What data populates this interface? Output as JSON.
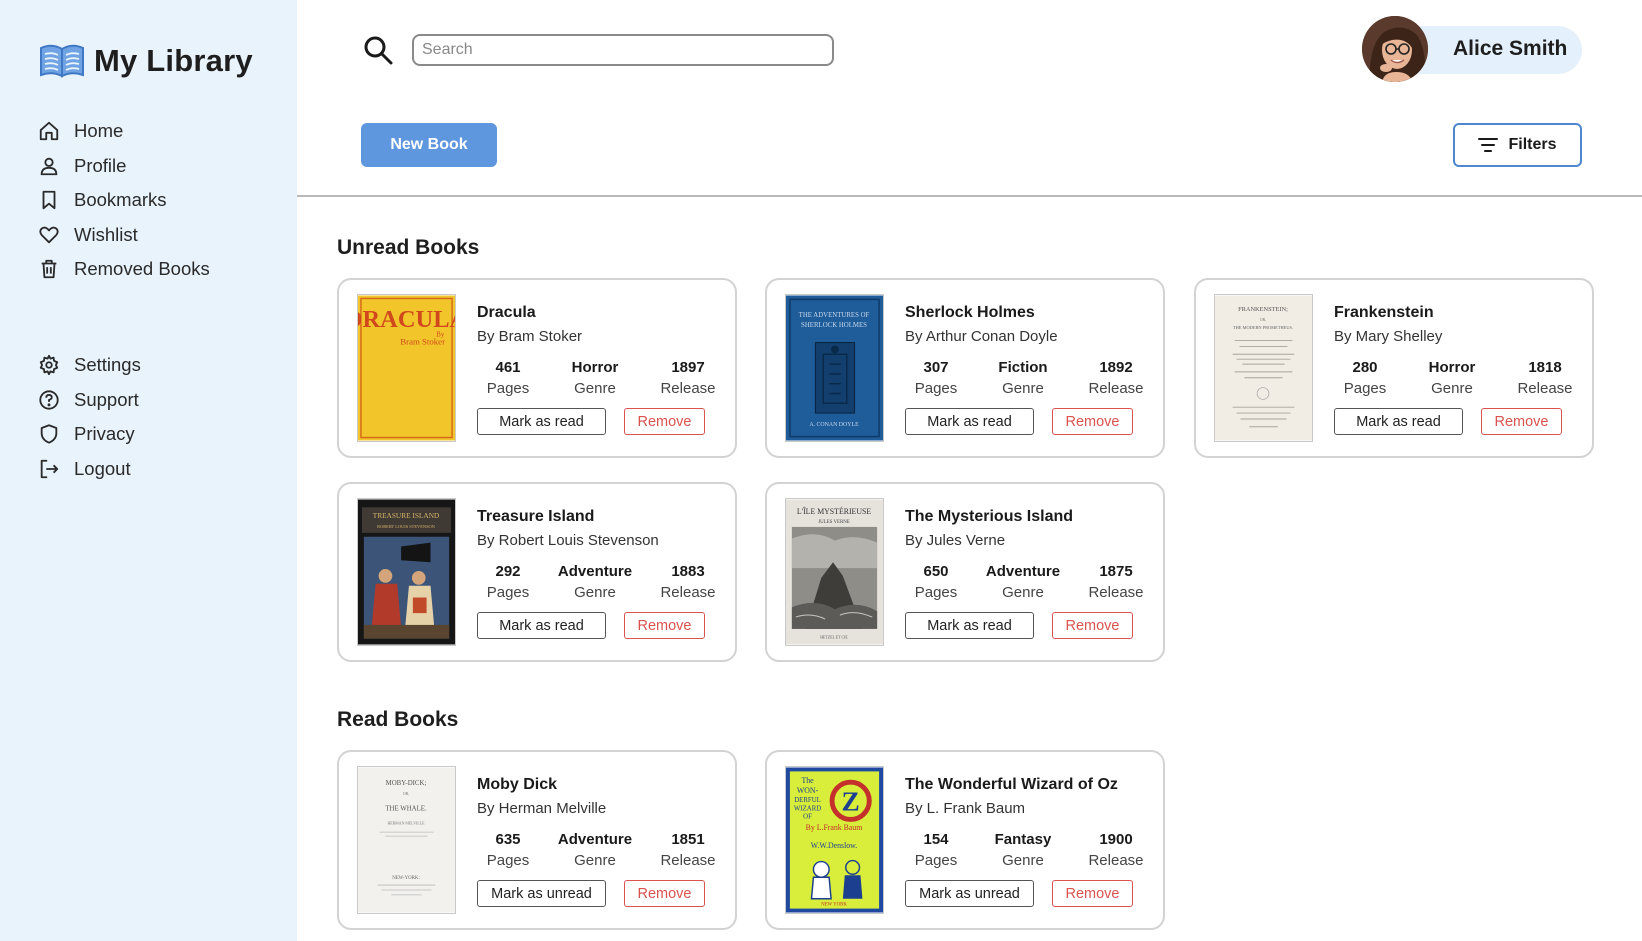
{
  "app": {
    "title": "My Library",
    "accent_color": "#5f97df",
    "sidebar_color": "#e9f3fc",
    "danger_color": "#d9534f"
  },
  "sidebar": {
    "primary": [
      {
        "label": "Home",
        "icon": "home-icon"
      },
      {
        "label": "Profile",
        "icon": "user-icon"
      },
      {
        "label": "Bookmarks",
        "icon": "bookmark-icon"
      },
      {
        "label": "Wishlist",
        "icon": "heart-icon"
      },
      {
        "label": "Removed Books",
        "icon": "trash-icon"
      }
    ],
    "secondary": [
      {
        "label": "Settings",
        "icon": "gear-icon"
      },
      {
        "label": "Support",
        "icon": "help-circle-icon"
      },
      {
        "label": "Privacy",
        "icon": "shield-icon"
      },
      {
        "label": "Logout",
        "icon": "logout-icon"
      }
    ]
  },
  "header": {
    "search_placeholder": "Search",
    "search_value": "",
    "user_name": "Alice Smith",
    "new_book_label": "New Book",
    "filters_label": "Filters"
  },
  "sections": {
    "unread_title": "Unread Books",
    "read_title": "Read Books"
  },
  "stat_labels": {
    "pages": "Pages",
    "genre": "Genre",
    "release": "Release"
  },
  "actions": {
    "mark_read": "Mark as read",
    "mark_unread": "Mark as unread",
    "remove": "Remove"
  },
  "unread_books": [
    {
      "title": "Dracula",
      "author": "By Bram Stoker",
      "pages": "461",
      "genre": "Horror",
      "release": "1897",
      "cover": "dracula-cover"
    },
    {
      "title": "Sherlock Holmes",
      "author": "By Arthur Conan Doyle",
      "pages": "307",
      "genre": "Fiction",
      "release": "1892",
      "cover": "sherlock-cover"
    },
    {
      "title": "Frankenstein",
      "author": "By Mary Shelley",
      "pages": "280",
      "genre": "Horror",
      "release": "1818",
      "cover": "frankenstein-cover"
    },
    {
      "title": "Treasure Island",
      "author": "By Robert Louis Stevenson",
      "pages": "292",
      "genre": "Adventure",
      "release": "1883",
      "cover": "treasure-island-cover"
    },
    {
      "title": "The Mysterious Island",
      "author": "By Jules Verne",
      "pages": "650",
      "genre": "Adventure",
      "release": "1875",
      "cover": "mysterious-island-cover"
    }
  ],
  "read_books": [
    {
      "title": "Moby Dick",
      "author": "By Herman Melville",
      "pages": "635",
      "genre": "Adventure",
      "release": "1851",
      "cover": "moby-dick-cover"
    },
    {
      "title": "The Wonderful Wizard of Oz",
      "author": "By L. Frank Baum",
      "pages": "154",
      "genre": "Fantasy",
      "release": "1900",
      "cover": "wizard-of-oz-cover"
    }
  ]
}
